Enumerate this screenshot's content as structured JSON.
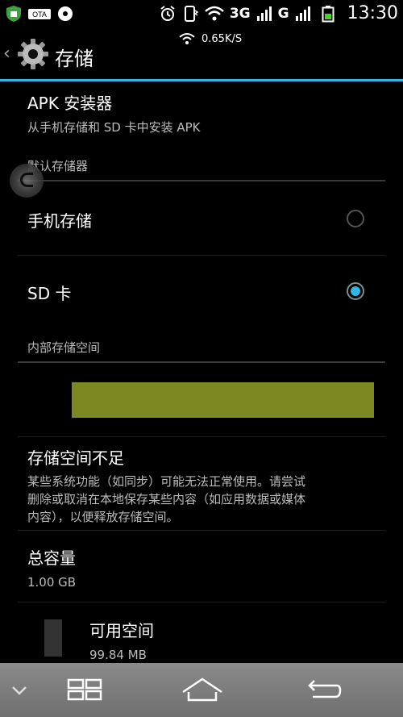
{
  "status_bar": {
    "time": "13:30",
    "net_speed": "0.65K/S",
    "ota_label": "OTA",
    "network_1": "3G",
    "network_2": "G"
  },
  "header": {
    "title": "存储"
  },
  "apk_installer": {
    "title": "APK 安装器",
    "subtitle": "从手机存储和 SD 卡中安装 APK"
  },
  "default_storage": {
    "section_label": "默认存储器",
    "options": [
      {
        "label": "手机存储",
        "selected": false
      },
      {
        "label": "SD 卡",
        "selected": true
      }
    ]
  },
  "internal_storage": {
    "section_label": "内部存储空间",
    "used_fraction": 1.0,
    "bar_color": "#7b8720"
  },
  "low_space": {
    "title": "存储空间不足",
    "line1": "某些系统功能（如同步）可能无法正常使用。请尝试",
    "line2": "删除或取消在本地保存某些内容（如应用数据或媒体",
    "line3": "内容），以便释放存储空间。"
  },
  "total_capacity": {
    "title": "总容量",
    "value": "1.00 GB"
  },
  "available": {
    "title": "可用空间",
    "value": "99.84 MB"
  },
  "accent_color": "#33b5e5"
}
